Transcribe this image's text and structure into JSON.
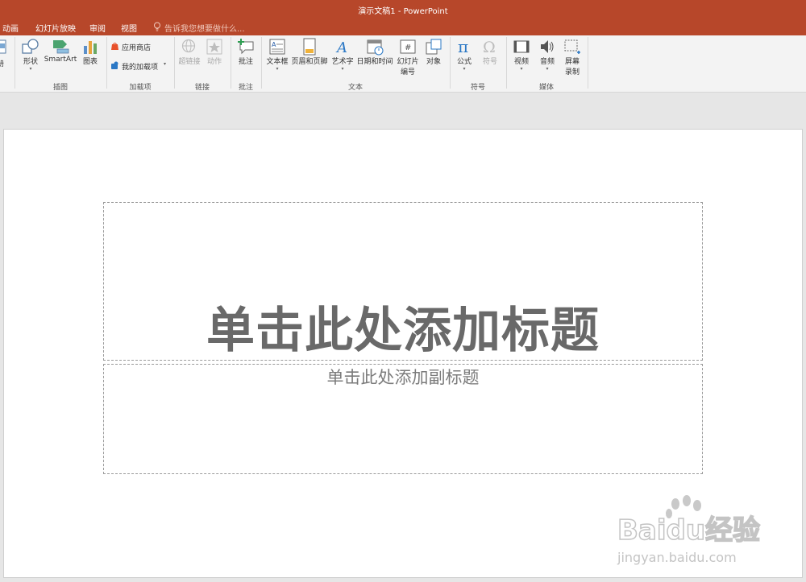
{
  "window": {
    "title": "演示文稿1 - PowerPoint"
  },
  "menu": {
    "items": [
      "动画",
      "幻灯片放映",
      "审阅",
      "视图"
    ],
    "search_placeholder": "告诉我您想要做什么..."
  },
  "ribbon": {
    "partial_left_label": "册",
    "illustrations": {
      "shapes": "形状",
      "smartart": "SmartArt",
      "chart": "图表",
      "group": "插图"
    },
    "addins": {
      "store": "应用商店",
      "my_addins": "我的加载项",
      "group": "加载项"
    },
    "links": {
      "hyperlink": "超链接",
      "action": "动作",
      "group": "链接"
    },
    "comments": {
      "comment": "批注",
      "group": "批注"
    },
    "text": {
      "textbox": "文本框",
      "header_footer": "页眉和页脚",
      "wordart": "艺术字",
      "datetime": "日期和时间",
      "slide_number_1": "幻灯片",
      "slide_number_2": "编号",
      "object": "对象",
      "group": "文本"
    },
    "symbols": {
      "equation": "公式",
      "symbol": "符号",
      "group": "符号"
    },
    "media": {
      "video": "视频",
      "audio": "音频",
      "screen_rec_1": "屏幕",
      "screen_rec_2": "录制",
      "group": "媒体"
    }
  },
  "slide": {
    "title_placeholder": "单击此处添加标题",
    "subtitle_placeholder": "单击此处添加副标题"
  },
  "watermark": {
    "brand": "Baidu经验",
    "url": "jingyan.baidu.com"
  }
}
